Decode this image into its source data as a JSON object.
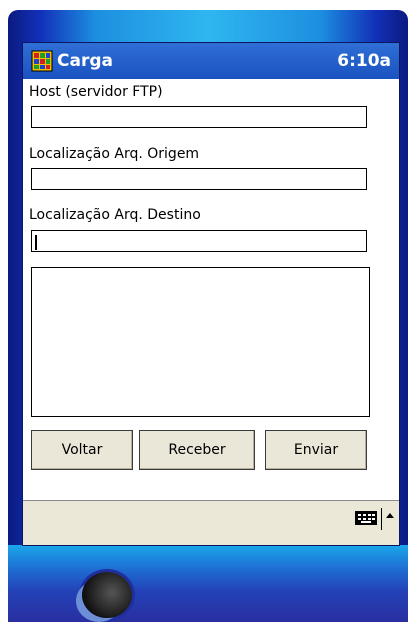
{
  "titlebar": {
    "app_icon": "app-grid-icon",
    "title": "Carga",
    "time": "6:10a"
  },
  "form": {
    "host_label": "Host (servidor FTP)",
    "host_value": "",
    "origin_label": "Localização Arq. Origem",
    "origin_value": "",
    "dest_label": "Localização Arq. Destino",
    "dest_value": "",
    "log_value": ""
  },
  "buttons": {
    "back": "Voltar",
    "receive": "Receber",
    "send": "Enviar"
  },
  "menubar": {
    "keyboard_icon": "keyboard-icon",
    "sip_arrow": "up-arrow-icon"
  },
  "colors": {
    "titlebar": "#1a52c0",
    "button_face": "#ebe7d8",
    "menubar": "#ece8d8"
  }
}
